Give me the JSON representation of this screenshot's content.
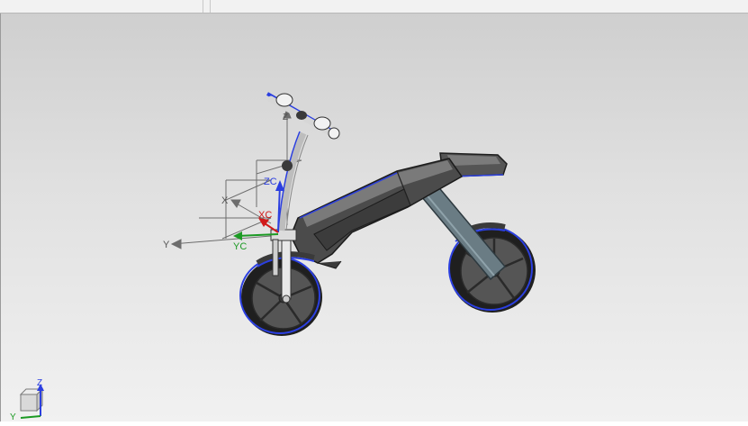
{
  "window": {
    "title": ""
  },
  "scene": {
    "model": "balance-bike",
    "wcs_labels": {
      "x": "X",
      "y": "Y",
      "z": "Z"
    },
    "csys_labels": {
      "xc": "XC",
      "yc": "YC",
      "zc": "ZC"
    },
    "triad_labels": {
      "z": "Z",
      "y": "Y"
    }
  },
  "colors": {
    "background_top": "#cfcfcf",
    "background_bottom": "#f1f1f1",
    "body_dark": "#4a4a4a",
    "body_mid": "#6c6c6c",
    "tire": "#2e2e2e",
    "edge_highlight": "#2b3fe0",
    "xc_axis": "#d11a1a",
    "yc_axis": "#1c9a24",
    "zc_axis": "#2c3fe0",
    "handle_grip": "#f2f2f2",
    "strut": "#6a7c84"
  }
}
